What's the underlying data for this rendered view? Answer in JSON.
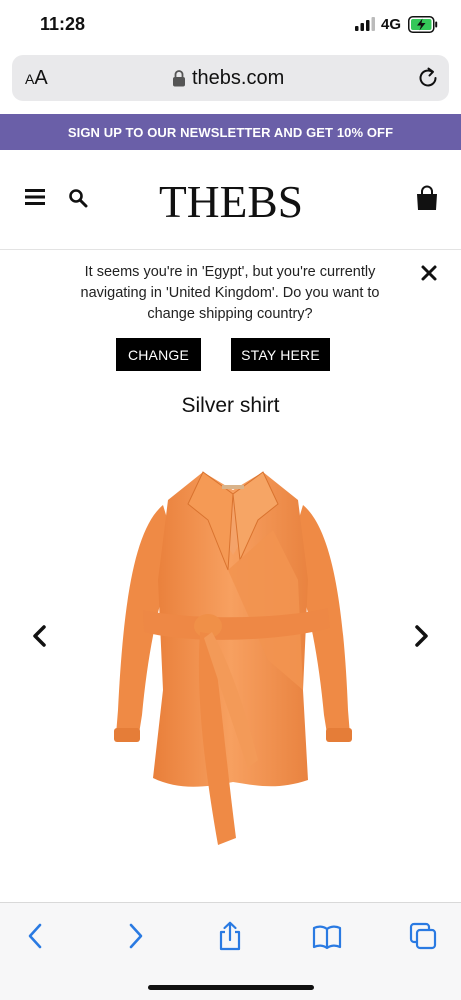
{
  "status": {
    "time": "11:28",
    "network": "4G"
  },
  "browser": {
    "text_size_label": "AA",
    "url": "thebs.com"
  },
  "promo": {
    "text": "SIGN UP TO OUR NEWSLETTER AND GET 10% OFF",
    "background": "#6a5fa8"
  },
  "header": {
    "logo_text": "THEBS"
  },
  "notice": {
    "message": "It seems you're in 'Egypt', but you're currently navigating in 'United Kingdom'. Do you want to change shipping country?",
    "change_label": "CHANGE",
    "stay_label": "STAY HERE"
  },
  "product": {
    "title": "Silver shirt",
    "image_color": "#f3914c"
  },
  "icons": [
    "signal-icon",
    "battery-icon",
    "lock-icon",
    "reload-icon",
    "menu-icon",
    "search-icon",
    "bag-icon",
    "close-icon",
    "chevron-left-icon",
    "chevron-right-icon",
    "back-icon",
    "forward-icon",
    "share-icon",
    "bookmarks-icon",
    "tabs-icon"
  ]
}
